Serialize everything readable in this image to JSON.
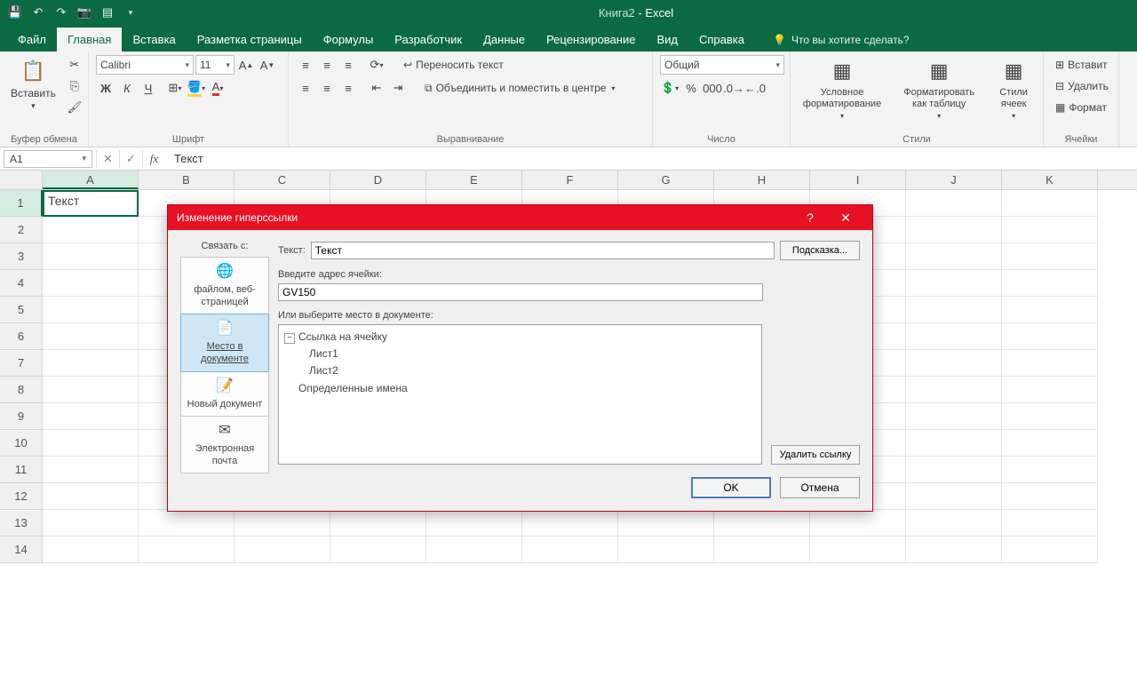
{
  "app": {
    "title_doc": "Книга2",
    "title_app": "Excel"
  },
  "tabs": {
    "file": "Файл",
    "home": "Главная",
    "insert": "Вставка",
    "layout": "Разметка страницы",
    "formulas": "Формулы",
    "developer": "Разработчик",
    "data": "Данные",
    "review": "Рецензирование",
    "view": "Вид",
    "help": "Справка",
    "tellme": "Что вы хотите сделать?"
  },
  "ribbon": {
    "clipboard": {
      "paste": "Вставить",
      "label": "Буфер обмена"
    },
    "font": {
      "name": "Calibri",
      "size": "11",
      "label": "Шрифт",
      "bold": "Ж",
      "italic": "К",
      "underline": "Ч"
    },
    "align": {
      "wrap": "Переносить текст",
      "merge": "Объединить и поместить в центре",
      "label": "Выравнивание"
    },
    "number": {
      "format": "Общий",
      "label": "Число"
    },
    "styles": {
      "cond": "Условное форматирование",
      "table": "Форматировать как таблицу",
      "cell": "Стили ячеек",
      "label": "Стили"
    },
    "cells": {
      "insert": "Вставит",
      "delete": "Удалить",
      "format": "Формат",
      "label": "Ячейки"
    }
  },
  "formulabar": {
    "name": "A1",
    "value": "Текст"
  },
  "grid": {
    "cols": [
      "A",
      "B",
      "C",
      "D",
      "E",
      "F",
      "G",
      "H",
      "I",
      "J",
      "K"
    ],
    "a1": "Текст"
  },
  "dialog": {
    "title": "Изменение гиперссылки",
    "linkto_label": "Связать с:",
    "opts": {
      "file": "файлом, веб-страницей",
      "place": "Место в документе",
      "new": "Новый документ",
      "mail": "Электронная почта"
    },
    "text_label": "Текст:",
    "text_value": "Текст",
    "hint_btn": "Подсказка...",
    "addr_label": "Введите адрес ячейки:",
    "addr_value": "GV150",
    "tree_label": "Или выберите место в документе:",
    "tree": {
      "root": "Ссылка на ячейку",
      "s1": "Лист1",
      "s2": "Лист2",
      "names": "Определенные имена"
    },
    "remove": "Удалить ссылку",
    "ok": "OK",
    "cancel": "Отмена"
  }
}
